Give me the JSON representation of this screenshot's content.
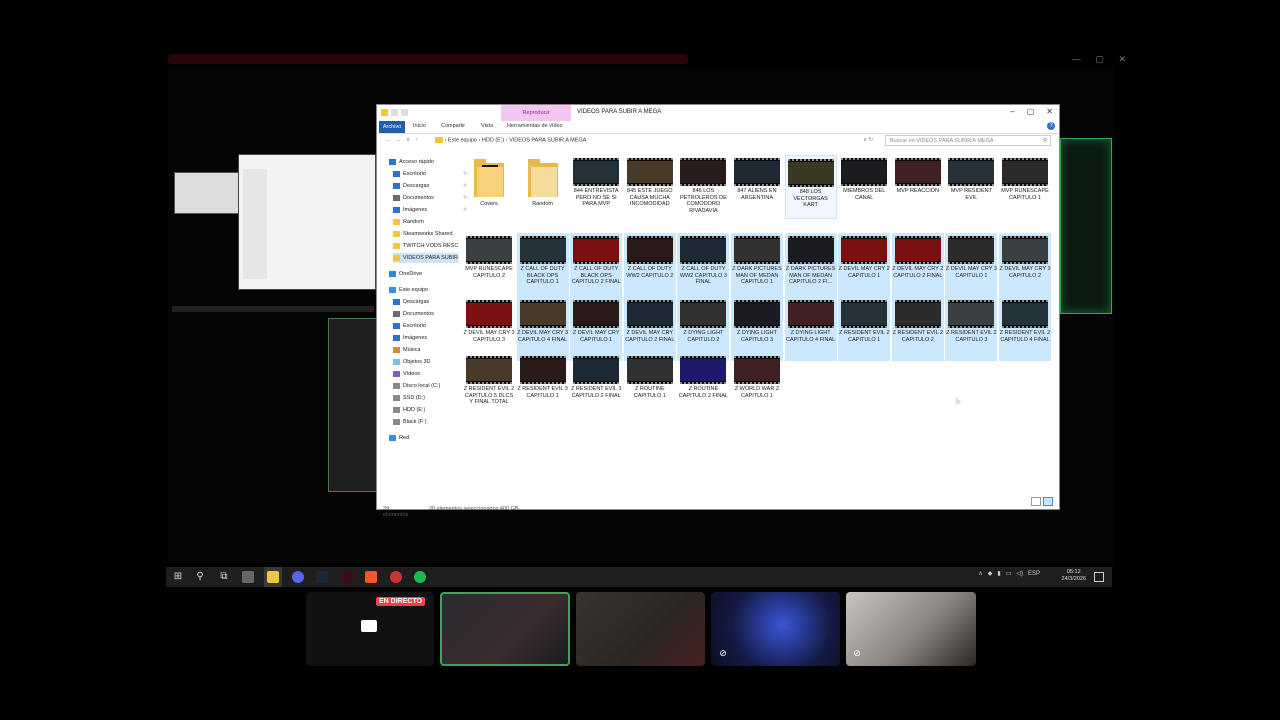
{
  "explorer": {
    "context_tab": "Reproducir",
    "title": "VIDEOS PARA SUBIR A MEGA",
    "ribbon_tabs": [
      "Archivo",
      "Inicio",
      "Compartir",
      "Vista",
      "Herramientas de vídeo"
    ],
    "breadcrumb": [
      "Este equipo",
      "HDD (E:)",
      "VIDEOS PARA SUBIR A MEGA"
    ],
    "search_placeholder": "Buscar en VIDEOS PARA SUBIR A MEGA",
    "nav": {
      "quick_access": "Acceso rápido",
      "quick_items": [
        "Escritorio",
        "Descargas",
        "Documentos",
        "Imágenes",
        "Random",
        "Steamworks Shared",
        "TWITCH VODS RESC",
        "VIDEOS PARA SUBIR"
      ],
      "onedrive": "OneDrive",
      "this_pc": "Este equipo",
      "pc_items": [
        "Descargas",
        "Documentos",
        "Escritorio",
        "Imágenes",
        "Música",
        "Objetos 3D",
        "Vídeos",
        "Disco local (C:)",
        "SSD (D:)",
        "HDD (E:)",
        "Black (F:)"
      ],
      "network": "Red"
    },
    "files": [
      {
        "name": "Covers",
        "kind": "folder",
        "selected": false
      },
      {
        "name": "Random",
        "kind": "folder-light",
        "selected": false
      },
      {
        "name": "844 ENTREVISTA PERO NO SE SI PARA MVP",
        "kind": "video",
        "selected": false
      },
      {
        "name": "845 ESTE JUEGO CAUSA MUCHA INCOMODIDAD",
        "kind": "video",
        "selected": false
      },
      {
        "name": "846 LOS PETROLEROS DE COMODORO RIVADAVIA",
        "kind": "video",
        "selected": false
      },
      {
        "name": "847 ALIENS EN ARGENTINA",
        "kind": "video",
        "selected": false
      },
      {
        "name": "848 LOS VECTORGAS KART",
        "kind": "video",
        "selected": false,
        "hot": true
      },
      {
        "name": "MIEMBROS DEL CANAL",
        "kind": "video",
        "selected": false
      },
      {
        "name": "MVP REACCIÓN",
        "kind": "video",
        "selected": false
      },
      {
        "name": "MVP RESIDENT EVIL",
        "kind": "video",
        "selected": false
      },
      {
        "name": "MVP RUNESCAPE CAPITULO 1",
        "kind": "video",
        "selected": false
      },
      {
        "name": "MVP RUNESCAPE CAPITULO 2",
        "kind": "video",
        "selected": false
      },
      {
        "name": "Z CALL OF DUTY BLACK OPS CAPITULO 1",
        "kind": "video",
        "selected": true
      },
      {
        "name": "Z CALL OF DUTY BLACK OPS CAPITULO 2 FINAL",
        "kind": "video",
        "selected": true
      },
      {
        "name": "Z CALL OF DUTY WW2 CAPITULO 2",
        "kind": "video",
        "selected": true
      },
      {
        "name": "Z CALL OF DUTY WW2 CAPITULO 3 FINAL",
        "kind": "video",
        "selected": true
      },
      {
        "name": "Z DARK PICTURES MAN OF MEDAN CAPITULO 1",
        "kind": "video",
        "selected": true
      },
      {
        "name": "Z DARK PICTURES MAN OF MEDAN CAPITULO 2 FI...",
        "kind": "video",
        "selected": true
      },
      {
        "name": "Z DEVIL MAY CRY 2 CAPITULO 1",
        "kind": "video",
        "selected": true
      },
      {
        "name": "Z DEVIL MAY CRY 2 CAPITULO 2 FINAL",
        "kind": "video",
        "selected": true
      },
      {
        "name": "Z DEVIL MAY CRY 3 CAPITULO 1",
        "kind": "video",
        "selected": true
      },
      {
        "name": "Z DEVIL MAY CRY 3 CAPITULO 2",
        "kind": "video",
        "selected": true
      },
      {
        "name": "Z DEVIL MAY CRY 3 CAPITULO 3",
        "kind": "video",
        "selected": false
      },
      {
        "name": "Z DEVIL MAY CRY 3 CAPITULO 4 FINAL",
        "kind": "video",
        "selected": true
      },
      {
        "name": "Z DEVIL MAY CRY CAPITULO 1",
        "kind": "video",
        "selected": true
      },
      {
        "name": "Z DEVIL MAY CRY CAPITULO 2 FINAL",
        "kind": "video",
        "selected": true
      },
      {
        "name": "Z DYING LIGHT CAPITULO 2",
        "kind": "video",
        "selected": true
      },
      {
        "name": "Z DYING LIGHT CAPITULO 3",
        "kind": "video",
        "selected": true
      },
      {
        "name": "Z DYING LIGHT CAPITULO 4 FINAL",
        "kind": "video",
        "selected": true
      },
      {
        "name": "Z RESIDENT EVIL 2 CAPITULO 1",
        "kind": "video",
        "selected": true
      },
      {
        "name": "Z RESIDENT EVIL 2 CAPITULO 2",
        "kind": "video",
        "selected": true
      },
      {
        "name": "Z RESIDENT EVIL 2 CAPITULO 3",
        "kind": "video",
        "selected": true
      },
      {
        "name": "Z RESIDENT EVIL 2 CAPITULO 4 FINAL",
        "kind": "video",
        "selected": true
      },
      {
        "name": "Z RESIDENT EVIL 2 CAPITULO 5 DLCS Y FINAL TOTAL",
        "kind": "video",
        "selected": false
      },
      {
        "name": "Z RESIDENT EVIL 3 CAPITULO 1",
        "kind": "video",
        "selected": false
      },
      {
        "name": "Z RESIDENT EVIL 3 CAPITULO 2 FINAL",
        "kind": "video",
        "selected": false
      },
      {
        "name": "Z ROUTINE CAPITULO 1",
        "kind": "video",
        "selected": false
      },
      {
        "name": "Z ROUTINE CAPITULO 2 FINAL",
        "kind": "video",
        "selected": false
      },
      {
        "name": "Z WORLD WAR Z CAPITULO 1",
        "kind": "video",
        "selected": false
      }
    ],
    "status": {
      "count": "39 elementos",
      "selection": "20 elementos seleccionados  400 GB"
    }
  },
  "taskbar": {
    "lang": "ESP",
    "time": "05:12",
    "date": "24/3/2026"
  },
  "call": {
    "live_badge": "EN DIRECTO"
  },
  "colors": {
    "selection": "#cce8ff",
    "context_tab": "#f2c6ef",
    "live_red": "#ed4245",
    "speaking_green": "#3ba55c"
  }
}
